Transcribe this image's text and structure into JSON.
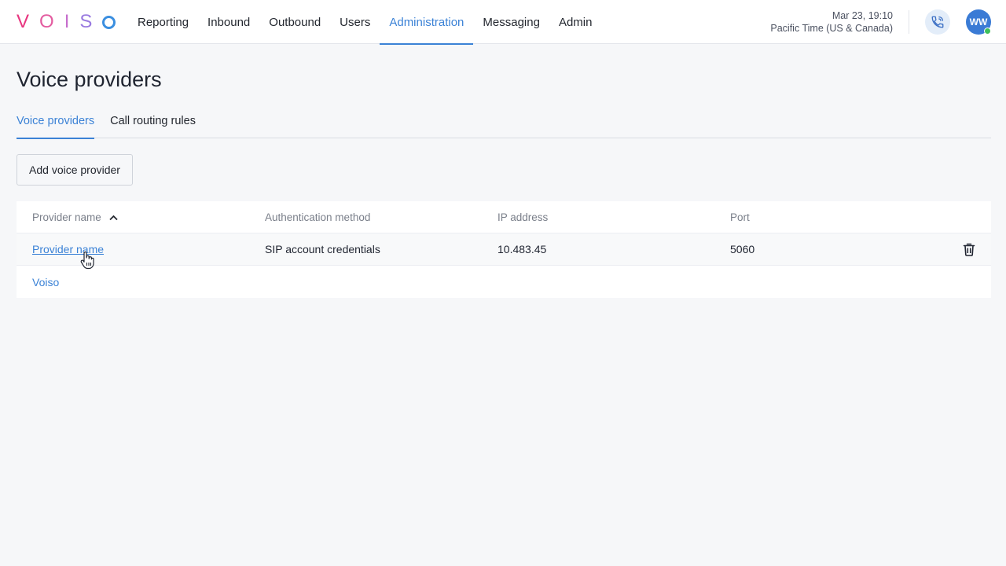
{
  "logo": {
    "letters": [
      "V",
      "O",
      "I",
      "S",
      "O"
    ],
    "colors": [
      "#e8357f",
      "#e35ca0",
      "#c66ecc",
      "#9a7be0",
      "#3b8fe0"
    ]
  },
  "nav": {
    "items": [
      {
        "label": "Reporting",
        "active": false
      },
      {
        "label": "Inbound",
        "active": false
      },
      {
        "label": "Outbound",
        "active": false
      },
      {
        "label": "Users",
        "active": false
      },
      {
        "label": "Administration",
        "active": true
      },
      {
        "label": "Messaging",
        "active": false
      },
      {
        "label": "Admin",
        "active": false
      }
    ]
  },
  "clock": {
    "datetime": "Mar 23, 19:10",
    "timezone": "Pacific Time (US & Canada)"
  },
  "user": {
    "initials": "WW",
    "status": "online",
    "avatar_color": "#3a7bd5"
  },
  "page": {
    "title": "Voice providers"
  },
  "tabs": [
    {
      "label": "Voice providers",
      "active": true
    },
    {
      "label": "Call routing rules",
      "active": false
    }
  ],
  "toolbar": {
    "add_label": "Add voice provider"
  },
  "table": {
    "columns": [
      "Provider name",
      "Authentication method",
      "IP address",
      "Port"
    ],
    "sort": {
      "column": "Provider name",
      "direction": "ascending"
    },
    "rows": [
      {
        "name": "Provider name",
        "auth": "SIP account credentials",
        "ip": "10.483.45",
        "port": "5060",
        "deletable": true
      },
      {
        "name": "Voiso",
        "auth": "",
        "ip": "",
        "port": "",
        "deletable": false
      }
    ]
  },
  "colors": {
    "accent": "#3b82d6",
    "background": "#f6f7f9",
    "online": "#3fbf5a"
  }
}
